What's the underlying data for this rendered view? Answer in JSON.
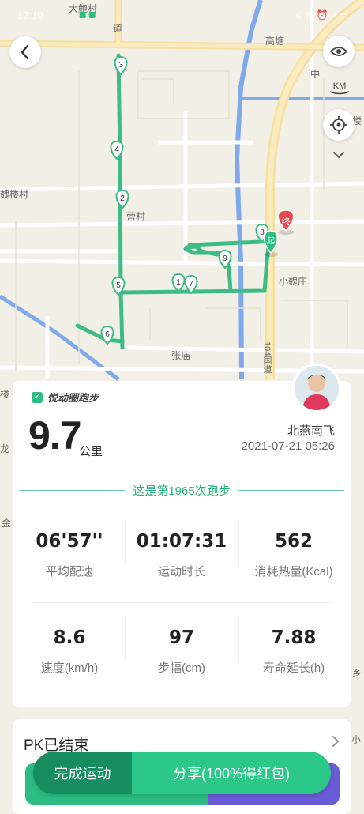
{
  "status_bar": {
    "time": "12:10",
    "right": "⊙ ✉ ⏰ ◔ ▭"
  },
  "map": {
    "place_labels": {
      "village_top": "大鲍村",
      "gaotang": "高塘",
      "zhong": "中",
      "lou": "楼",
      "weilou": "魏楼村",
      "yingcun": "营村",
      "xiaoweizhuang": "小魏庄",
      "zhangmiao": "张庙",
      "road_104": "104国道",
      "lou2": "楼",
      "long": "龙",
      "jin": "金",
      "xiao": "小",
      "xiang": "乡",
      "dao": "道"
    },
    "markers": [
      {
        "label": "3"
      },
      {
        "label": "4"
      },
      {
        "label": "2"
      },
      {
        "label": "5"
      },
      {
        "label": "6"
      },
      {
        "label": "1"
      },
      {
        "label": "7"
      },
      {
        "label": "9"
      },
      {
        "label": "8"
      }
    ],
    "start_label": "起",
    "end_label": "终",
    "km_label": "KM",
    "route_color": "#3dbc85"
  },
  "card": {
    "brand": "悦动圈跑步",
    "distance": "9.7",
    "distance_unit": "公里",
    "user_name": "北燕南飞",
    "date": "2021-07-21 05:26",
    "run_count_text": "这是第1965次跑步",
    "stats": [
      {
        "value": "06'57''",
        "label": "平均配速"
      },
      {
        "value": "01:07:31",
        "label": "运动时长"
      },
      {
        "value": "562",
        "label": "消耗热量(Kcal)"
      },
      {
        "value": "8.6",
        "label": "速度(km/h)"
      },
      {
        "value": "97",
        "label": "步幅(cm)"
      },
      {
        "value": "7.88",
        "label": "寿命延长(h)"
      }
    ]
  },
  "pk": {
    "title": "PK已结束"
  },
  "actions": {
    "finish": "完成运动",
    "share": "分享(100%得红包)"
  },
  "colors": {
    "accent": "#2bbd83",
    "dark_accent": "#178c5f",
    "pk_purple": "#6b5bd6",
    "end_red": "#e84c4c"
  }
}
